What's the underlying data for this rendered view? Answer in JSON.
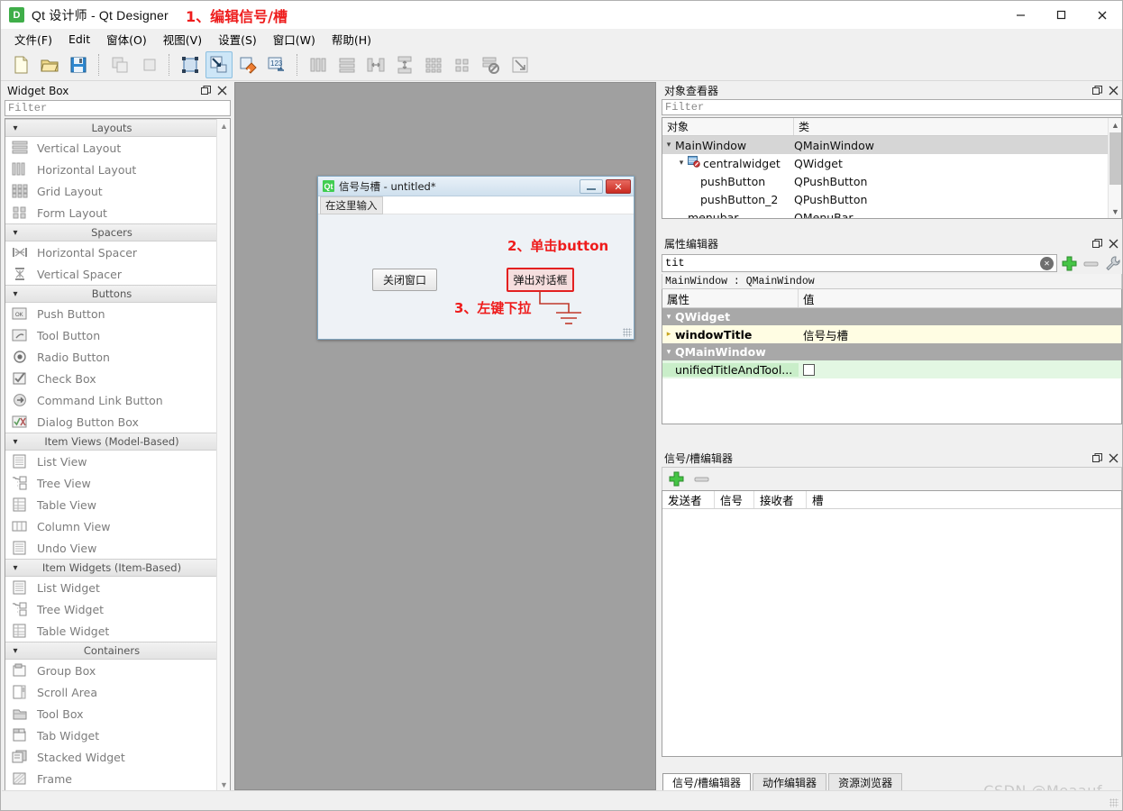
{
  "window": {
    "app_icon_letter": "D",
    "title": "Qt 设计师 - Qt Designer",
    "annotation_1": "1、编辑信号/槽",
    "controls": {
      "minimize": "minimize-icon",
      "maximize": "maximize-icon",
      "close": "close-icon"
    }
  },
  "menubar": {
    "items": [
      {
        "label": "文件(F)"
      },
      {
        "label": "Edit"
      },
      {
        "label": "窗体(O)"
      },
      {
        "label": "视图(V)"
      },
      {
        "label": "设置(S)"
      },
      {
        "label": "窗口(W)"
      },
      {
        "label": "帮助(H)"
      }
    ]
  },
  "toolbar": {
    "groups": [
      {
        "buttons": [
          {
            "name": "new-form-icon",
            "title": "新建"
          },
          {
            "name": "open-form-icon",
            "title": "打开"
          },
          {
            "name": "save-form-icon",
            "title": "保存"
          }
        ]
      },
      {
        "buttons": [
          {
            "name": "undo-icon",
            "title": "撤销"
          },
          {
            "name": "redo-icon",
            "title": "重做"
          }
        ]
      },
      {
        "buttons": [
          {
            "name": "edit-widgets-icon",
            "title": "编辑控件",
            "active": false
          },
          {
            "name": "edit-signals-slots-icon",
            "title": "编辑信号/槽",
            "active": true
          },
          {
            "name": "edit-buddies-icon",
            "title": "编辑伙伴",
            "active": false
          },
          {
            "name": "edit-tab-order-icon",
            "title": "编辑Tab顺序",
            "active": false
          }
        ]
      },
      {
        "buttons": [
          {
            "name": "layout-horizontally-icon",
            "title": "水平布局"
          },
          {
            "name": "layout-vertically-icon",
            "title": "垂直布局"
          },
          {
            "name": "layout-splitter-horizontal-icon",
            "title": "水平分裂器布局"
          },
          {
            "name": "layout-splitter-vertical-icon",
            "title": "垂直分裂器布局"
          },
          {
            "name": "layout-grid-icon",
            "title": "栅格布局"
          },
          {
            "name": "layout-form-icon",
            "title": "表单布局"
          },
          {
            "name": "break-layout-icon",
            "title": "打破布局"
          },
          {
            "name": "adjust-size-icon",
            "title": "调整大小"
          }
        ]
      }
    ]
  },
  "widget_box": {
    "title": "Widget Box",
    "filter_placeholder": "Filter",
    "float_icon": "restore-icon",
    "close_icon": "close-icon",
    "categories": [
      {
        "label": "Layouts",
        "items": [
          {
            "label": "Vertical Layout",
            "icon": "vertical-layout-icon"
          },
          {
            "label": "Horizontal Layout",
            "icon": "horizontal-layout-icon"
          },
          {
            "label": "Grid Layout",
            "icon": "grid-layout-icon"
          },
          {
            "label": "Form Layout",
            "icon": "form-layout-icon"
          }
        ]
      },
      {
        "label": "Spacers",
        "items": [
          {
            "label": "Horizontal Spacer",
            "icon": "horizontal-spacer-icon"
          },
          {
            "label": "Vertical Spacer",
            "icon": "vertical-spacer-icon"
          }
        ]
      },
      {
        "label": "Buttons",
        "items": [
          {
            "label": "Push Button",
            "icon": "push-button-icon"
          },
          {
            "label": "Tool Button",
            "icon": "tool-button-icon"
          },
          {
            "label": "Radio Button",
            "icon": "radio-button-icon"
          },
          {
            "label": "Check Box",
            "icon": "check-box-icon"
          },
          {
            "label": "Command Link Button",
            "icon": "command-link-button-icon"
          },
          {
            "label": "Dialog Button Box",
            "icon": "dialog-button-box-icon"
          }
        ]
      },
      {
        "label": "Item Views (Model-Based)",
        "items": [
          {
            "label": "List View",
            "icon": "list-view-icon"
          },
          {
            "label": "Tree View",
            "icon": "tree-view-icon"
          },
          {
            "label": "Table View",
            "icon": "table-view-icon"
          },
          {
            "label": "Column View",
            "icon": "column-view-icon"
          },
          {
            "label": "Undo View",
            "icon": "undo-view-icon"
          }
        ]
      },
      {
        "label": "Item Widgets (Item-Based)",
        "items": [
          {
            "label": "List Widget",
            "icon": "list-widget-icon"
          },
          {
            "label": "Tree Widget",
            "icon": "tree-widget-icon"
          },
          {
            "label": "Table Widget",
            "icon": "table-widget-icon"
          }
        ]
      },
      {
        "label": "Containers",
        "items": [
          {
            "label": "Group Box",
            "icon": "group-box-icon"
          },
          {
            "label": "Scroll Area",
            "icon": "scroll-area-icon"
          },
          {
            "label": "Tool Box",
            "icon": "tool-box-icon"
          },
          {
            "label": "Tab Widget",
            "icon": "tab-widget-icon"
          },
          {
            "label": "Stacked Widget",
            "icon": "stacked-widget-icon"
          },
          {
            "label": "Frame",
            "icon": "frame-icon"
          }
        ]
      }
    ]
  },
  "form": {
    "qt_badge": "Qt",
    "title": "信号与槽 - untitled*",
    "menu_placeholder": "在这里输入",
    "minimize_icon": "minimize-icon",
    "close_icon": "close-icon",
    "buttons": [
      {
        "label": "关闭窗口",
        "name": "close-window-button",
        "selected": false
      },
      {
        "label": "弹出对话框",
        "name": "popup-dialog-button",
        "selected": true
      }
    ],
    "annotation_2": "2、单击button",
    "annotation_3": "3、左键下拉"
  },
  "object_inspector": {
    "title": "对象查看器",
    "filter_placeholder": "Filter",
    "columns": [
      "对象",
      "类"
    ],
    "rows": [
      {
        "object": "MainWindow",
        "class": "QMainWindow",
        "depth": 0,
        "expanded": true,
        "selected": true,
        "icon": ""
      },
      {
        "object": "centralwidget",
        "class": "QWidget",
        "depth": 1,
        "expanded": true,
        "selected": false,
        "icon": "central-widget-icon"
      },
      {
        "object": "pushButton",
        "class": "QPushButton",
        "depth": 2,
        "expanded": false,
        "selected": false,
        "icon": ""
      },
      {
        "object": "pushButton_2",
        "class": "QPushButton",
        "depth": 2,
        "expanded": false,
        "selected": false,
        "icon": ""
      },
      {
        "object": "menubar",
        "class": "QMenuBar",
        "depth": 1,
        "expanded": false,
        "selected": false,
        "icon": ""
      }
    ]
  },
  "property_editor": {
    "title": "属性编辑器",
    "search_value": "tit",
    "clear_icon": "clear-icon",
    "add_icon": "add-icon",
    "remove_icon": "remove-icon",
    "configure_icon": "wrench-icon",
    "object_line": "MainWindow : QMainWindow",
    "columns": [
      "属性",
      "值"
    ],
    "groups": [
      {
        "name": "QWidget",
        "rows": [
          {
            "key": "windowTitle",
            "value": "信号与槽",
            "style": "yellow",
            "expandable": true
          }
        ]
      },
      {
        "name": "QMainWindow",
        "rows": [
          {
            "key": "unifiedTitleAndTool...",
            "value": "",
            "style": "green",
            "checkbox": true,
            "checked": false
          }
        ]
      }
    ]
  },
  "signal_slot_editor": {
    "title": "信号/槽编辑器",
    "add_icon": "add-icon",
    "remove_icon": "remove-icon",
    "columns": [
      "发送者",
      "信号",
      "接收者",
      "槽"
    ],
    "rows": []
  },
  "bottom_tabs": [
    {
      "label": "信号/槽编辑器",
      "active": true
    },
    {
      "label": "动作编辑器",
      "active": false
    },
    {
      "label": "资源浏览器",
      "active": false
    }
  ],
  "watermark": "CSDN @Meaauf"
}
